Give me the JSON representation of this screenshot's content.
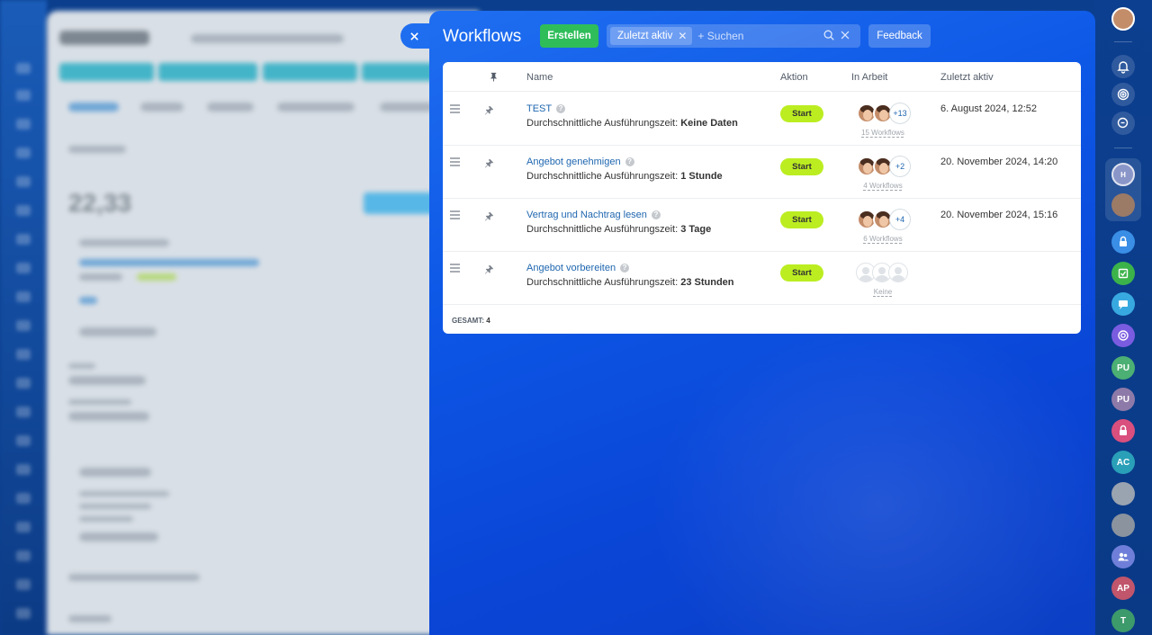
{
  "panel": {
    "title": "Workflows",
    "create_label": "Erstellen",
    "filter_chip": "Zuletzt aktiv",
    "search_placeholder": "+ Suchen",
    "feedback_label": "Feedback"
  },
  "grid": {
    "columns": {
      "name": "Name",
      "action": "Aktion",
      "in_progress": "In Arbeit",
      "last_active": "Zuletzt aktiv"
    },
    "avg_time_prefix": "Durchschnittliche Ausführungszeit:",
    "rows": [
      {
        "name": "TEST",
        "avg_time": "Keine Daten",
        "action": "Start",
        "extra_count": "+13",
        "running_link": "15 Workflows",
        "last_active": "6. August 2024, 12:52"
      },
      {
        "name": "Angebot genehmigen",
        "avg_time": "1 Stunde",
        "action": "Start",
        "extra_count": "+2",
        "running_link": "4 Workflows",
        "last_active": "20. November 2024, 14:20"
      },
      {
        "name": "Vertrag und Nachtrag lesen",
        "avg_time": "3 Tage",
        "action": "Start",
        "extra_count": "+4",
        "running_link": "6 Workflows",
        "last_active": "20. November 2024, 15:16"
      },
      {
        "name": "Angebot vorbereiten",
        "avg_time": "23 Stunden",
        "action": "Start",
        "extra_count": "",
        "running_link": "Keine",
        "last_active": ""
      }
    ],
    "total_label": "GESAMT:",
    "total_value": "4"
  },
  "right_rail": {
    "initials": [
      "PU",
      "PU",
      "AC",
      "AP",
      "T"
    ]
  },
  "colors": {
    "panel_blue": "#1f6ef0",
    "create_green": "#2fbd5a",
    "start_lime": "#bbed21",
    "link_blue": "#2067b0"
  }
}
